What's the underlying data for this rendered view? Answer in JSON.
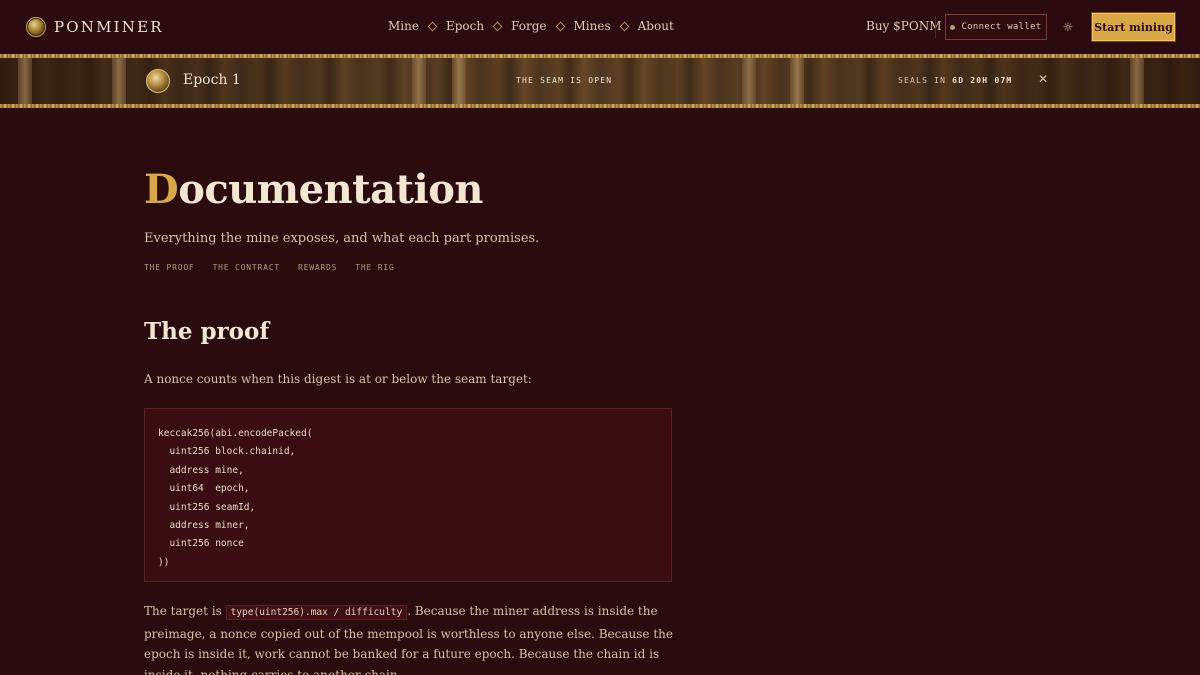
{
  "nav": {
    "brand": "PONMINER",
    "menu": [
      "Mine",
      "Epoch",
      "Forge",
      "Mines",
      "About"
    ],
    "buy_label": "Buy $PONM",
    "connect_label": "Connect wallet",
    "start_label": "Start mining",
    "theme_icon": "☼"
  },
  "banner": {
    "epoch_title": "Epoch 1",
    "status": "THE SEAM IS OPEN",
    "seals_prefix": "SEALS IN",
    "seals_days": "6D",
    "seals_hours": "20H",
    "seals_minutes": "07M",
    "close_icon": "✕"
  },
  "doc": {
    "title_initial": "D",
    "title_rest": "ocumentation",
    "subtitle": "Everything the mine exposes, and what each part promises.",
    "toc": [
      "THE PROOF",
      "THE CONTRACT",
      "REWARDS",
      "THE RIG"
    ]
  },
  "proof": {
    "heading": "The proof",
    "intro": "A nonce counts when this digest is at or below the seam target:",
    "code": [
      "keccak256(abi.encodePacked(",
      "  uint256 block.chainid,",
      "  address mine,",
      "  uint64  epoch,",
      "  uint256 seamId,",
      "  address miner,",
      "  uint256 nonce",
      "))"
    ],
    "para_before": "The target is ",
    "para_code": "type(uint256).max / difficulty",
    "para_after": ". Because the miner address is inside the preimage, a nonce copied out of the mempool is worthless to anyone else. Because the epoch is inside it, work cannot be banked for a future epoch. Because the chain id is inside it, nothing carries to another chain."
  }
}
